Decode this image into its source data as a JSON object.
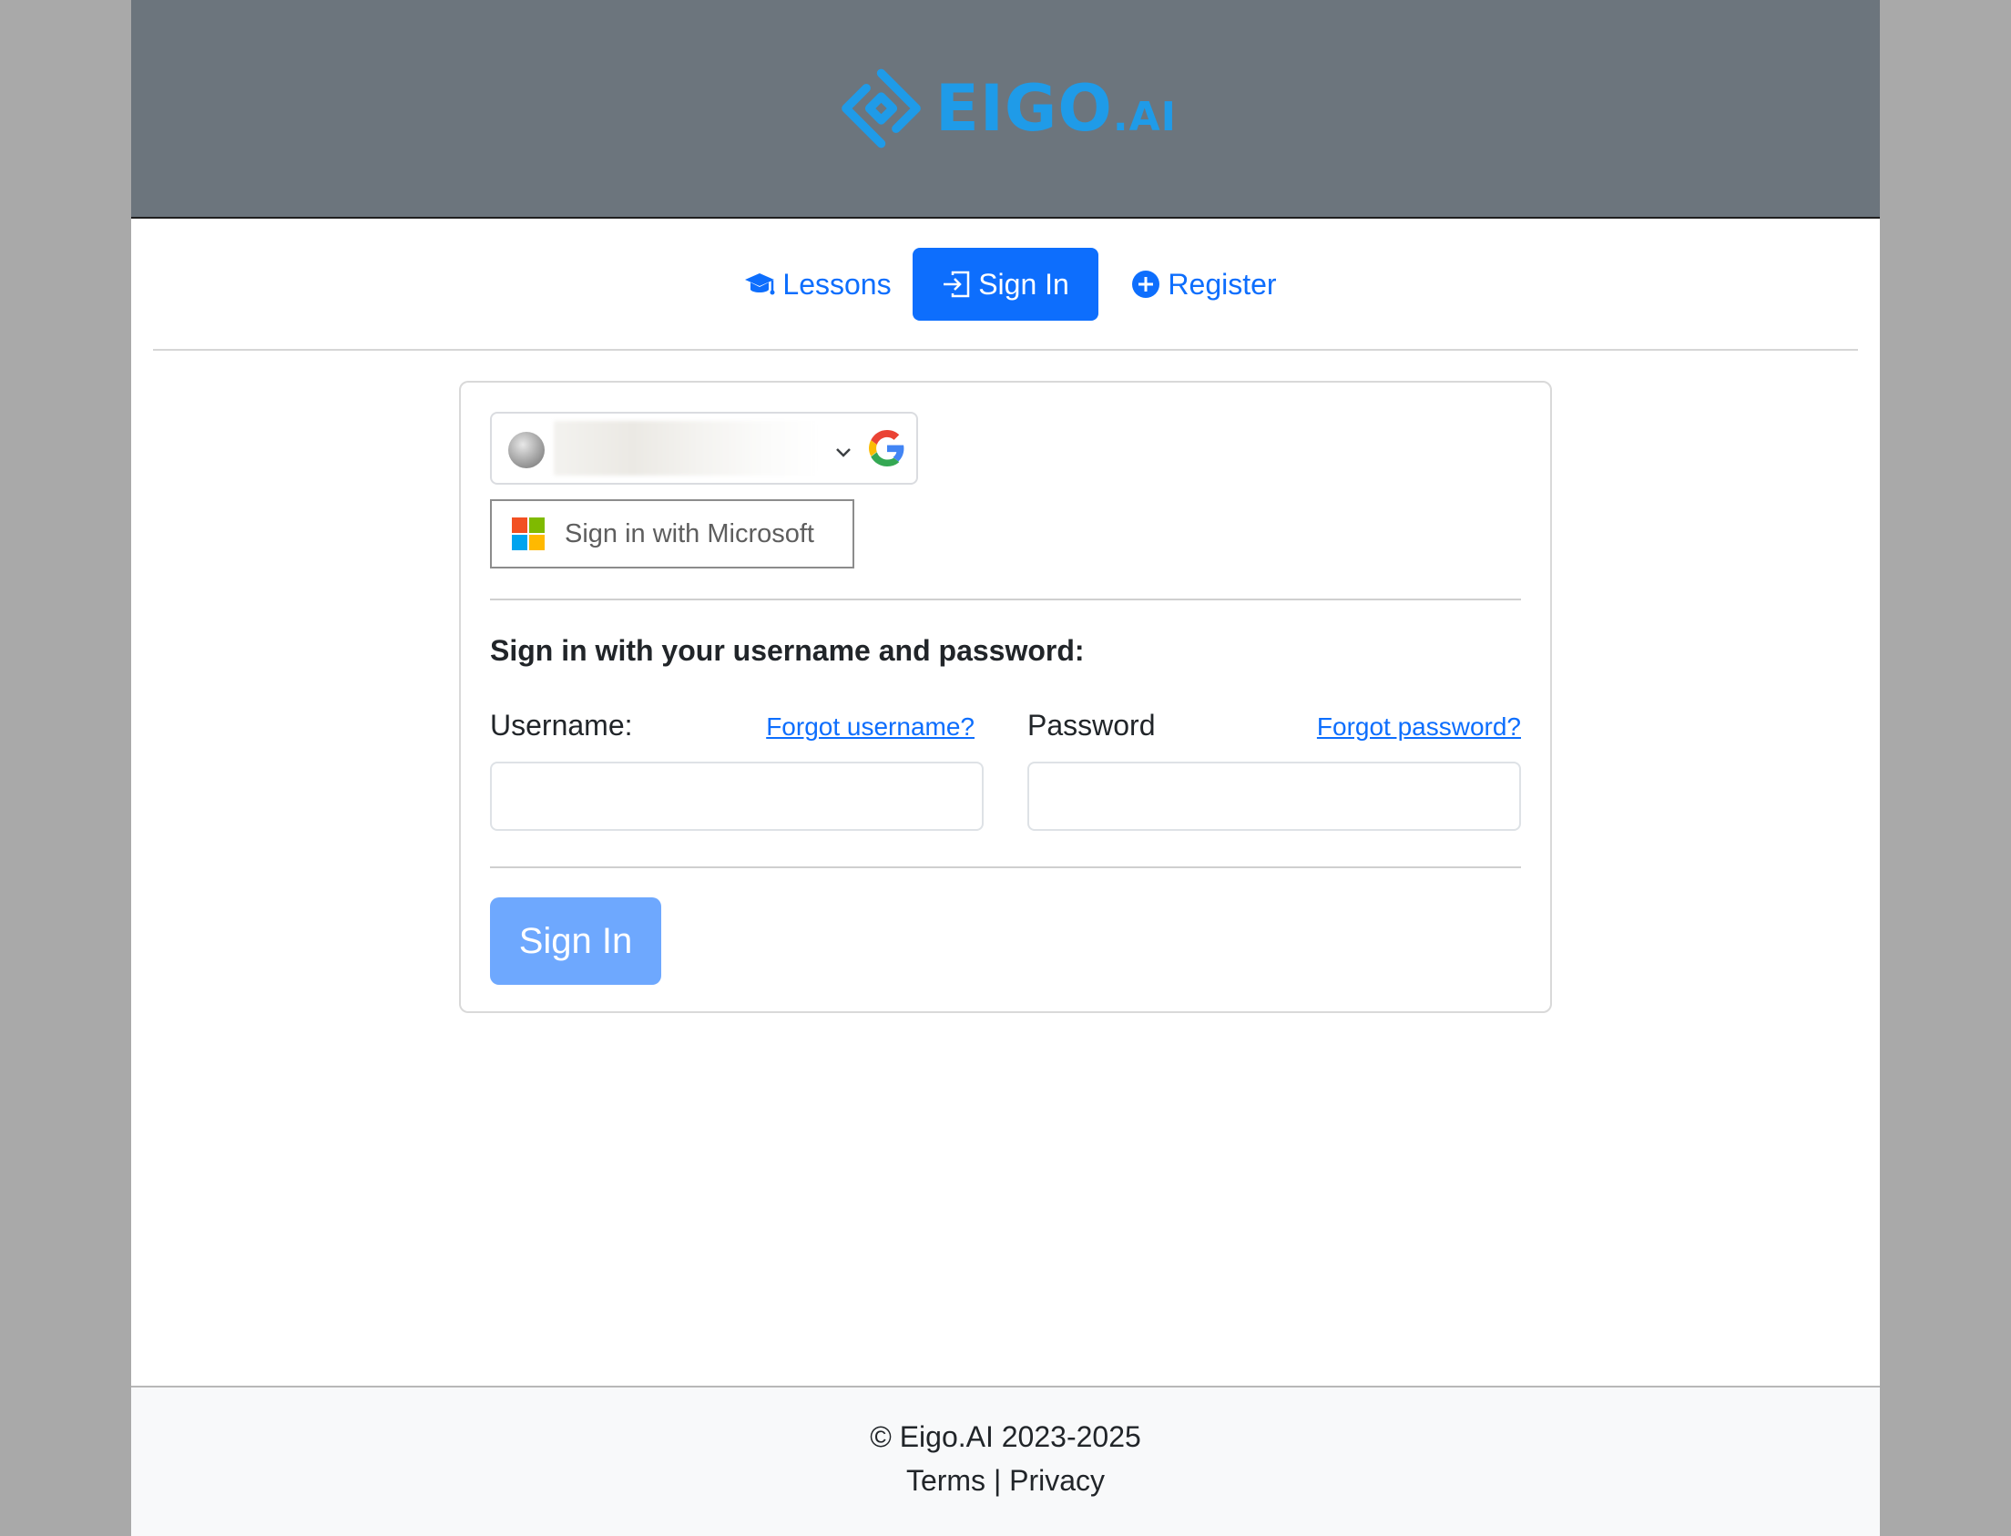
{
  "header": {
    "logo_text": "EIGO",
    "logo_suffix": ".AI",
    "logo_icon": "eigo-logo-icon"
  },
  "nav": {
    "items": [
      {
        "label": "Lessons",
        "icon": "graduation-cap-icon",
        "active": false
      },
      {
        "label": "Sign In",
        "icon": "sign-in-icon",
        "active": true
      },
      {
        "label": "Register",
        "icon": "plus-circle-icon",
        "active": false
      }
    ]
  },
  "oauth": {
    "google_icon": "google-icon",
    "microsoft_label": "Sign in with Microsoft",
    "microsoft_icon": "microsoft-icon"
  },
  "form": {
    "heading": "Sign in with your username and password:",
    "username_label": "Username:",
    "forgot_username": "Forgot username?",
    "password_label": "Password",
    "forgot_password": "Forgot password?",
    "username_value": "",
    "password_value": "",
    "submit_label": "Sign In"
  },
  "footer": {
    "copyright": "© Eigo.AI 2023-2025",
    "terms": "Terms",
    "separator": "|",
    "privacy": "Privacy"
  },
  "colors": {
    "header_bg": "#6c757d",
    "brand": "#1f9be8",
    "primary": "#0d6efd",
    "submit_disabled": "#6ea8fe"
  }
}
